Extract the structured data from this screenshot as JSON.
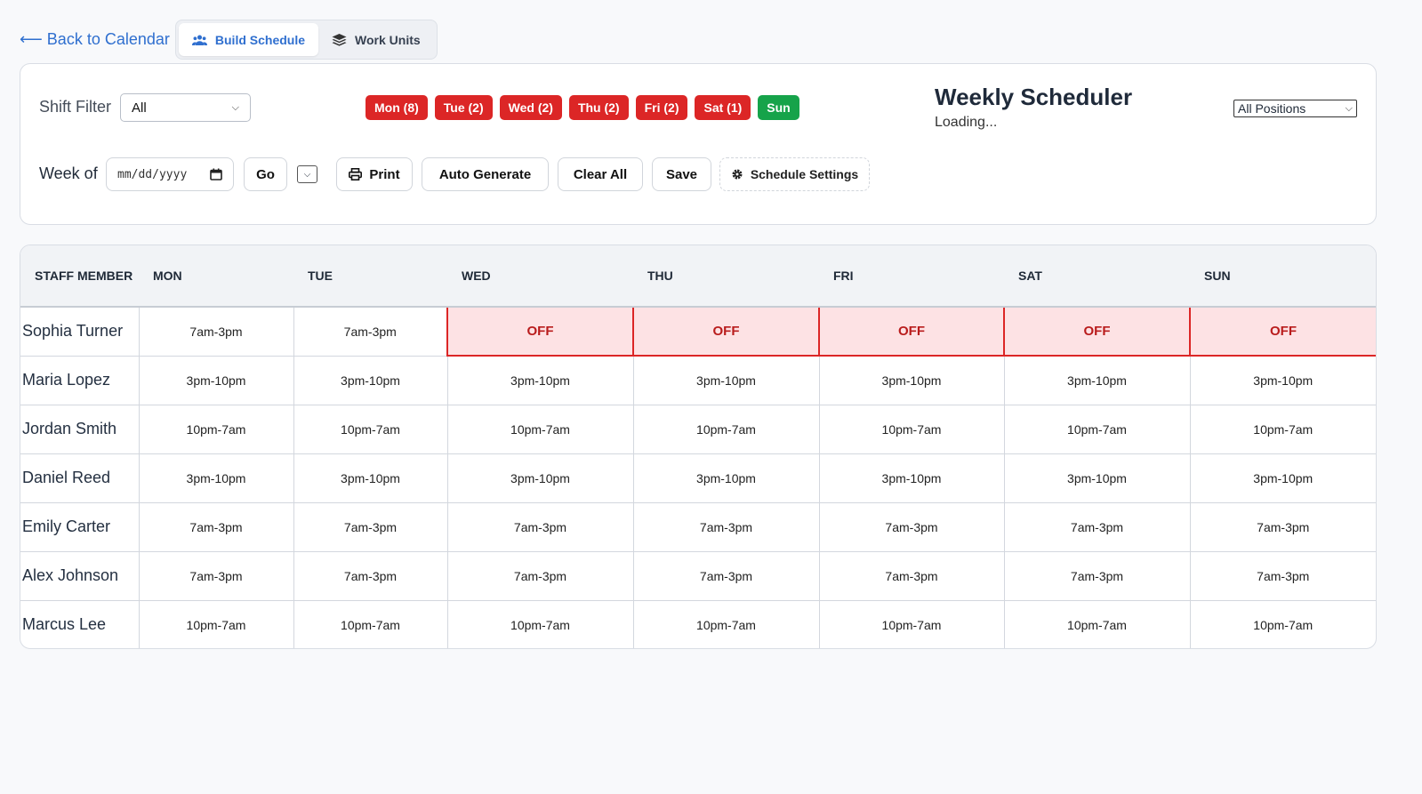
{
  "nav": {
    "back_label": "⟵ Back to Calendar",
    "tabs": [
      {
        "label": "Build Schedule",
        "icon": "users-icon",
        "active": true
      },
      {
        "label": "Work Units",
        "icon": "layers-icon",
        "active": false
      }
    ]
  },
  "filters": {
    "shift_filter_label": "Shift Filter",
    "shift_filter_value": "All",
    "week_of_label": "Week of",
    "date_placeholder": "mm/dd/yyyy",
    "positions_value": "All Positions"
  },
  "day_chips": [
    {
      "label": "Mon (8)",
      "status": "alert"
    },
    {
      "label": "Tue (2)",
      "status": "alert"
    },
    {
      "label": "Wed (2)",
      "status": "alert"
    },
    {
      "label": "Thu (2)",
      "status": "alert"
    },
    {
      "label": "Fri (2)",
      "status": "alert"
    },
    {
      "label": "Sat (1)",
      "status": "alert"
    },
    {
      "label": "Sun",
      "status": "ok"
    }
  ],
  "header": {
    "title": "Weekly Scheduler",
    "status": "Loading..."
  },
  "toolbar": {
    "go_label": "Go",
    "print_label": "Print",
    "auto_generate_label": "Auto Generate",
    "clear_all_label": "Clear All",
    "save_label": "Save",
    "settings_label": "Schedule Settings"
  },
  "schedule": {
    "columns": [
      "STAFF MEMBER",
      "MON",
      "TUE",
      "WED",
      "THU",
      "FRI",
      "SAT",
      "SUN"
    ],
    "rows": [
      {
        "name": "Sophia Turner",
        "shifts": [
          "7am-3pm",
          "7am-3pm",
          "OFF",
          "OFF",
          "OFF",
          "OFF",
          "OFF"
        ]
      },
      {
        "name": "Maria Lopez",
        "shifts": [
          "3pm-10pm",
          "3pm-10pm",
          "3pm-10pm",
          "3pm-10pm",
          "3pm-10pm",
          "3pm-10pm",
          "3pm-10pm"
        ]
      },
      {
        "name": "Jordan Smith",
        "shifts": [
          "10pm-7am",
          "10pm-7am",
          "10pm-7am",
          "10pm-7am",
          "10pm-7am",
          "10pm-7am",
          "10pm-7am"
        ]
      },
      {
        "name": "Daniel Reed",
        "shifts": [
          "3pm-10pm",
          "3pm-10pm",
          "3pm-10pm",
          "3pm-10pm",
          "3pm-10pm",
          "3pm-10pm",
          "3pm-10pm"
        ]
      },
      {
        "name": "Emily Carter",
        "shifts": [
          "7am-3pm",
          "7am-3pm",
          "7am-3pm",
          "7am-3pm",
          "7am-3pm",
          "7am-3pm",
          "7am-3pm"
        ]
      },
      {
        "name": "Alex Johnson",
        "shifts": [
          "7am-3pm",
          "7am-3pm",
          "7am-3pm",
          "7am-3pm",
          "7am-3pm",
          "7am-3pm",
          "7am-3pm"
        ]
      },
      {
        "name": "Marcus Lee",
        "shifts": [
          "10pm-7am",
          "10pm-7am",
          "10pm-7am",
          "10pm-7am",
          "10pm-7am",
          "10pm-7am",
          "10pm-7am"
        ]
      }
    ]
  },
  "colors": {
    "accent": "#2f6fcf",
    "alert": "#dc2626",
    "ok": "#16a34a",
    "off_bg": "#fde2e4"
  }
}
